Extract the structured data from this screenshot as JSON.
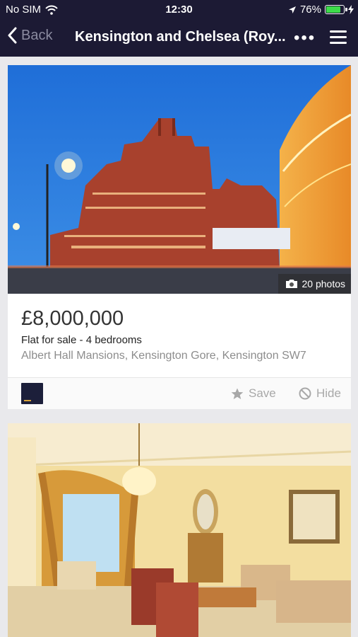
{
  "status_bar": {
    "carrier": "No SIM",
    "time": "12:30",
    "battery": "76%",
    "battery_level": 0.76,
    "icons": [
      "wifi-icon",
      "location-arrow-icon",
      "battery-icon",
      "charging-bolt-icon"
    ]
  },
  "nav": {
    "back_label": "Back",
    "title": "Kensington and Chelsea (Roy...",
    "more_label": "•••",
    "icons": [
      "chevron-left-icon",
      "more-dots-icon",
      "hamburger-menu-icon"
    ]
  },
  "listings": [
    {
      "photo_count": "20 photos",
      "price": "£8,000,000",
      "description": "Flat for sale - 4 bedrooms",
      "address": "Albert Hall Mansions, Kensington Gore, Kensington SW7",
      "save_label": "Save",
      "hide_label": "Hide"
    }
  ],
  "colors": {
    "nav_background": "#1c1a34",
    "page_background": "#e9e9ec",
    "muted_text": "#8d8d8d",
    "action_text": "#a8a8a8"
  }
}
